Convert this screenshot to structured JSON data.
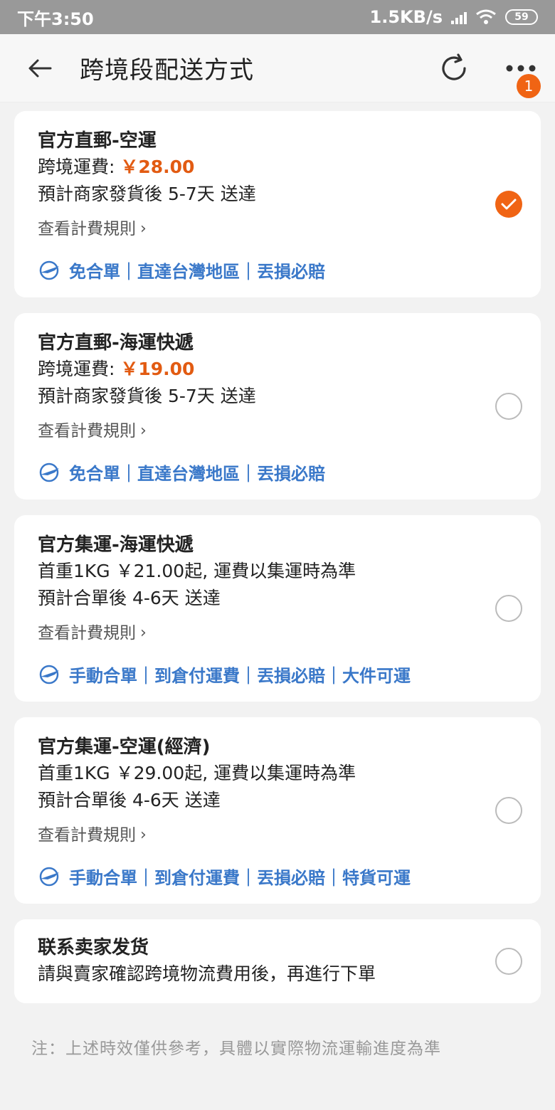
{
  "status_bar": {
    "time": "下午3:50",
    "speed": "1.5KB/s",
    "battery": "59"
  },
  "header": {
    "title": "跨境段配送方式",
    "badge_count": "1"
  },
  "options": [
    {
      "title": "官方直郵-空運",
      "fee_label": "跨境運費: ",
      "fee_value": "￥28.00",
      "line2": "預計商家發貨後 5-7天 送達",
      "rules_link": "查看計費規則",
      "tags": "免合單｜直達台灣地區｜丟損必賠",
      "selected": true
    },
    {
      "title": "官方直郵-海運快遞",
      "fee_label": "跨境運費: ",
      "fee_value": "￥19.00",
      "line2": "預計商家發貨後 5-7天 送達",
      "rules_link": "查看計費規則",
      "tags": "免合單｜直達台灣地區｜丟損必賠",
      "selected": false
    },
    {
      "title": "官方集運-海運快遞",
      "line1": "首重1KG ￥21.00起, 運費以集運時為準",
      "line2": "預計合單後 4-6天 送達",
      "rules_link": "查看計費規則",
      "tags": "手動合單｜到倉付運費｜丟損必賠｜大件可運",
      "selected": false
    },
    {
      "title": "官方集運-空運(經濟)",
      "line1": "首重1KG ￥29.00起, 運費以集運時為準",
      "line2": "預計合單後 4-6天 送達",
      "rules_link": "查看計費規則",
      "tags": "手動合單｜到倉付運費｜丟損必賠｜特貨可運",
      "selected": false
    },
    {
      "title": "联系卖家发货",
      "line1": "請與賣家確認跨境物流費用後，再進行下單",
      "selected": false
    }
  ],
  "footer_note": "注：上述時效僅供參考，具體以實際物流運輸進度為準",
  "colors": {
    "accent": "#f06414",
    "price": "#e25b12",
    "tag_blue": "#3a78c9",
    "status_bar": "#999999"
  },
  "icons": [
    "back-arrow-icon",
    "refresh-icon",
    "more-dots-icon",
    "plane-icon",
    "check-icon",
    "chevron-right-icon"
  ]
}
